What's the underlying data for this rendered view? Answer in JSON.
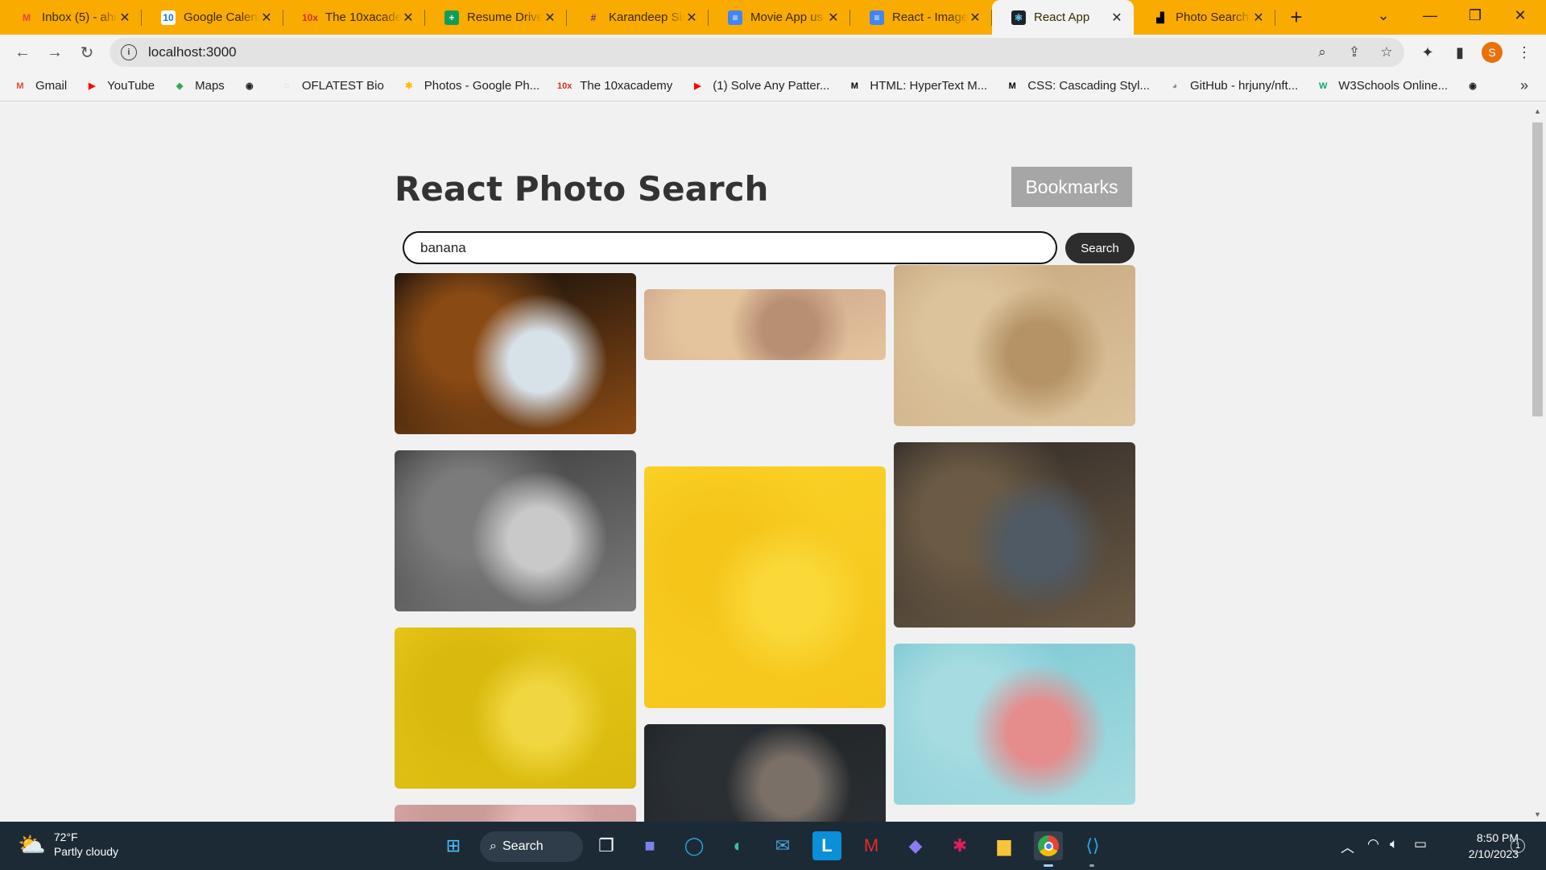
{
  "tabs": [
    {
      "title": "Inbox (5) - ahi",
      "icon": "M",
      "icon_color": "#ea4335",
      "icon_bg": "transparent"
    },
    {
      "title": "Google Calend",
      "icon": "10",
      "icon_color": "#1a73e8",
      "icon_bg": "#ffffff"
    },
    {
      "title": "The 10xacaden",
      "icon": "10x",
      "icon_color": "#d93025",
      "icon_bg": "transparent"
    },
    {
      "title": "Resume Drive",
      "icon": "+",
      "icon_color": "#ffffff",
      "icon_bg": "#0f9d58"
    },
    {
      "title": "Karandeep Sin",
      "icon": "#",
      "icon_color": "#6b2b91",
      "icon_bg": "transparent"
    },
    {
      "title": "Movie App us",
      "icon": "≡",
      "icon_color": "#ffffff",
      "icon_bg": "#4285f4"
    },
    {
      "title": "React - Image",
      "icon": "≡",
      "icon_color": "#ffffff",
      "icon_bg": "#4285f4"
    },
    {
      "title": "React App",
      "icon": "⚛",
      "icon_color": "#61dafb",
      "icon_bg": "#20232a"
    },
    {
      "title": "Photo Search",
      "icon": "▟",
      "icon_color": "#000000",
      "icon_bg": "transparent"
    }
  ],
  "browser": {
    "url": "localhost:3000",
    "profile_initial": "S"
  },
  "bookmarks": [
    {
      "label": "Gmail",
      "icon": "M",
      "color": "#ea4335"
    },
    {
      "label": "YouTube",
      "icon": "▶",
      "color": "#ff0000"
    },
    {
      "label": "Maps",
      "icon": "◆",
      "color": "#34a853"
    },
    {
      "label": "",
      "icon": "◉",
      "color": "#222222"
    },
    {
      "label": "OFLATEST Bio",
      "icon": "◌",
      "color": "#bbbbbb"
    },
    {
      "label": "Photos - Google Ph...",
      "icon": "✱",
      "color": "#fbbc04"
    },
    {
      "label": "The 10xacademy",
      "icon": "10x",
      "color": "#d93025"
    },
    {
      "label": "(1) Solve Any Patter...",
      "icon": "▶",
      "color": "#ff0000"
    },
    {
      "label": "HTML: HyperText M...",
      "icon": "M",
      "color": "#000000"
    },
    {
      "label": "CSS: Cascading Styl...",
      "icon": "M",
      "color": "#000000"
    },
    {
      "label": "GitHub - hrjuny/nft...",
      "icon": "◕",
      "color": "#888888"
    },
    {
      "label": "W3Schools Online...",
      "icon": "W",
      "color": "#04aa6d"
    },
    {
      "label": "",
      "icon": "◉",
      "color": "#222222"
    }
  ],
  "page": {
    "title": "React Photo Search",
    "bookmarks_button": "Bookmarks",
    "search_value": "banana",
    "search_button": "Search"
  },
  "photos": [
    {
      "name": "photo-bowl-apples-bananas-dark",
      "colors": [
        "#0b0b0b",
        "#8a4a14",
        "#d7e1e8"
      ]
    },
    {
      "name": "photo-bananas-croissant-flatlay",
      "colors": [
        "#caa089",
        "#e4c49d",
        "#b98f74"
      ]
    },
    {
      "name": "photo-oatmeal-coffee-top",
      "colors": [
        "#c7a87f",
        "#dcc39c",
        "#b59366"
      ]
    },
    {
      "name": "photo-plate-apples-bananas-bw",
      "colors": [
        "#3a3a3a",
        "#7b7b7b",
        "#c9c9c9"
      ]
    },
    {
      "name": "photo-bananas-yellow-bg",
      "colors": [
        "#fbd227",
        "#f5c51a",
        "#f9d838"
      ]
    },
    {
      "name": "photo-basket-apples-bananas",
      "colors": [
        "#2f2a28",
        "#6b5a44",
        "#4f5a64"
      ]
    },
    {
      "name": "photo-pineapple-fruits-yellow",
      "colors": [
        "#e8c81a",
        "#d9b90d",
        "#f0d640"
      ]
    },
    {
      "name": "photo-apple-slices-dark",
      "colors": [
        "#1f2326",
        "#2a2f33",
        "#7a7068"
      ]
    },
    {
      "name": "photo-fruit-party-table",
      "colors": [
        "#7cc8d1",
        "#a5dbe1",
        "#e58c8c"
      ]
    },
    {
      "name": "photo-pink-bottom",
      "colors": [
        "#d7a7a6",
        "#c99b99",
        "#e0b4b2"
      ]
    }
  ],
  "taskbar": {
    "temperature": "72°F",
    "weather": "Partly cloudy",
    "search_label": "Search",
    "time": "8:50 PM",
    "date": "2/10/2023",
    "notification_count": "1"
  }
}
